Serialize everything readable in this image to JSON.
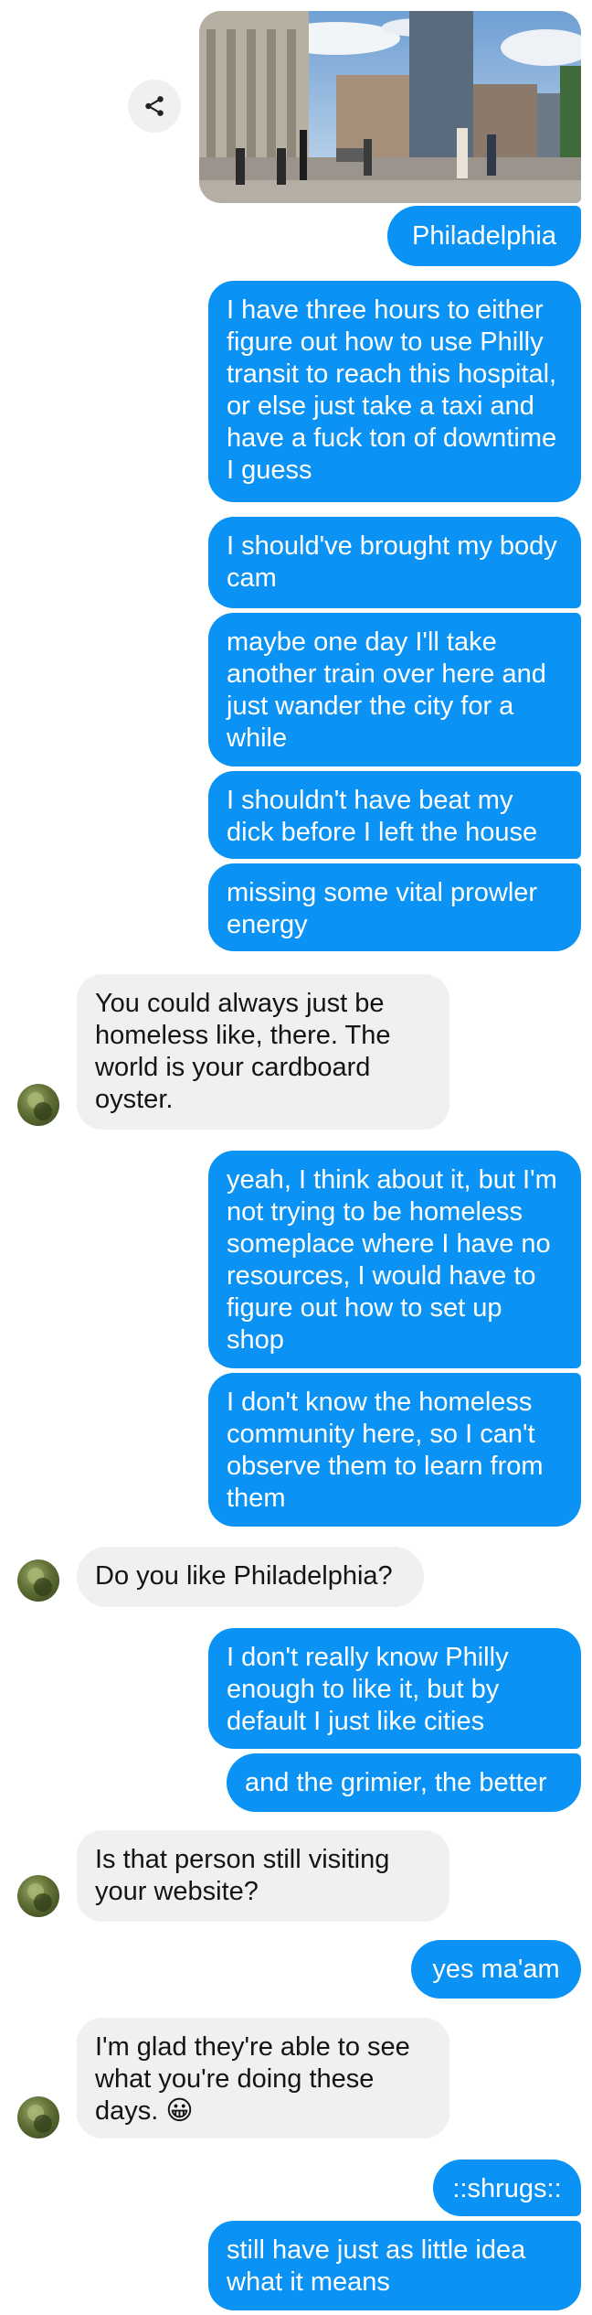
{
  "conversation": {
    "photo_caption": "Philadelphia",
    "messages": [
      {
        "dir": "out",
        "text": "I have three hours to either figure out how to use Philly transit to reach this hospital, or else just take a taxi and have a fuck ton of downtime I guess"
      },
      {
        "dir": "out",
        "text": "I should've brought my body cam"
      },
      {
        "dir": "out",
        "text": "maybe one day I'll take another train over here and just wander the city for a while"
      },
      {
        "dir": "out",
        "text": "I shouldn't have beat my dick before I left the house"
      },
      {
        "dir": "out",
        "text": "missing some vital prowler energy"
      },
      {
        "dir": "in",
        "text": "You could always just be homeless like, there. The world is your cardboard oyster."
      },
      {
        "dir": "out",
        "text": "yeah, I think about it, but I'm not trying to be homeless someplace where I have no resources, I would have to figure out how to set up shop"
      },
      {
        "dir": "out",
        "text": "I don't know the homeless community here, so I can't observe them to learn from them"
      },
      {
        "dir": "in",
        "text": "Do you like Philadelphia?"
      },
      {
        "dir": "out",
        "text": "I don't really know Philly enough to like it, but by default I just like cities"
      },
      {
        "dir": "out",
        "text": "and the grimier, the better"
      },
      {
        "dir": "in",
        "text": "Is that person still visiting your website?"
      },
      {
        "dir": "out",
        "text": "yes ma'am"
      },
      {
        "dir": "in",
        "text": "I'm glad they're able to see what you're doing these days. 😀"
      },
      {
        "dir": "out",
        "text": "::shrugs::"
      },
      {
        "dir": "out",
        "text": "still have just as little idea what it means"
      }
    ]
  },
  "colors": {
    "outgoing_bubble": "#0a93f5",
    "incoming_bubble": "#f0f0f0",
    "outgoing_text": "#ffffff",
    "incoming_text": "#141414"
  },
  "icons": {
    "share": "share-icon",
    "avatar": "contact-avatar"
  }
}
